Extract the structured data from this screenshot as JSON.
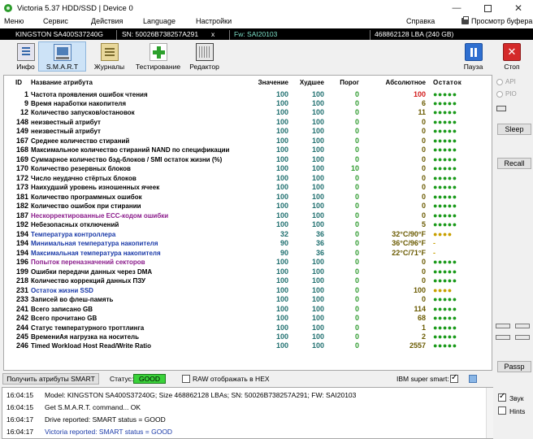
{
  "window": {
    "title": "Victoria 5.37 HDD/SSD | Device 0"
  },
  "menu": {
    "items": [
      "Меню",
      "Сервис",
      "Действия",
      "Language",
      "Настройки"
    ],
    "help": "Справка",
    "buffer": "Просмотр буфера"
  },
  "device": {
    "model": "KINGSTON SA400S37240G",
    "sn": "SN: 50026B738257A291",
    "close": "x",
    "fw": "Fw: SAI20103",
    "lba": "468862128 LBA (240 GB)"
  },
  "toolbar": {
    "info": "Инфо",
    "smart": "S.M.A.R.T",
    "journals": "Журналы",
    "testing": "Тестирование",
    "editor": "Редактор",
    "pause": "Пауза",
    "stop": "Стоп"
  },
  "smart": {
    "headers": {
      "id": "ID",
      "name": "Название атрибута",
      "value": "Значение",
      "worst": "Худшее",
      "threshold": "Порог",
      "absolute": "Абсолютное",
      "remaining": "Остаток"
    },
    "rows": [
      {
        "id": "1",
        "name": "Частота проявления ошибок чтения",
        "value": "100",
        "worst": "100",
        "threshold": "0",
        "absolute": "100",
        "remaining": "●●●●●"
      },
      {
        "id": "9",
        "name": "Время наработки накопителя",
        "value": "100",
        "worst": "100",
        "threshold": "0",
        "absolute": "6",
        "remaining": "●●●●●"
      },
      {
        "id": "12",
        "name": "Количество запусков/остановок",
        "value": "100",
        "worst": "100",
        "threshold": "0",
        "absolute": "11",
        "remaining": "●●●●●"
      },
      {
        "id": "148",
        "name": "неизвестный атрибут",
        "value": "100",
        "worst": "100",
        "threshold": "0",
        "absolute": "0",
        "remaining": "●●●●●"
      },
      {
        "id": "149",
        "name": "неизвестный атрибут",
        "value": "100",
        "worst": "100",
        "threshold": "0",
        "absolute": "0",
        "remaining": "●●●●●"
      },
      {
        "id": "167",
        "name": "Среднее количество стираний",
        "value": "100",
        "worst": "100",
        "threshold": "0",
        "absolute": "0",
        "remaining": "●●●●●"
      },
      {
        "id": "168",
        "name": "Максимальное количество стираний NAND по спецификации",
        "value": "100",
        "worst": "100",
        "threshold": "0",
        "absolute": "0",
        "remaining": "●●●●●"
      },
      {
        "id": "169",
        "name": "Суммарное количество бэд-блоков / SMI остаток жизни (%)",
        "value": "100",
        "worst": "100",
        "threshold": "0",
        "absolute": "0",
        "remaining": "●●●●●"
      },
      {
        "id": "170",
        "name": "Количество резервных блоков",
        "value": "100",
        "worst": "100",
        "threshold": "10",
        "absolute": "0",
        "remaining": "●●●●●"
      },
      {
        "id": "172",
        "name": "Число неудачно стёртых блоков",
        "value": "100",
        "worst": "100",
        "threshold": "0",
        "absolute": "0",
        "remaining": "●●●●●"
      },
      {
        "id": "173",
        "name": "Наихудший уровень изношенных ячеек",
        "value": "100",
        "worst": "100",
        "threshold": "0",
        "absolute": "0",
        "remaining": "●●●●●"
      },
      {
        "id": "181",
        "name": "Количество программных ошибок",
        "value": "100",
        "worst": "100",
        "threshold": "0",
        "absolute": "0",
        "remaining": "●●●●●"
      },
      {
        "id": "182",
        "name": "Количество ошибок при стирании",
        "value": "100",
        "worst": "100",
        "threshold": "0",
        "absolute": "0",
        "remaining": "●●●●●"
      },
      {
        "id": "187",
        "name": "Нескорректированные ECC-кодом ошибки",
        "value": "100",
        "worst": "100",
        "threshold": "0",
        "absolute": "0",
        "remaining": "●●●●●",
        "style": "warn"
      },
      {
        "id": "192",
        "name": "Небезопасных отключений",
        "value": "100",
        "worst": "100",
        "threshold": "0",
        "absolute": "5",
        "remaining": "●●●●●"
      },
      {
        "id": "194",
        "name": "Температура контроллера",
        "value": "32",
        "worst": "36",
        "threshold": "0",
        "absolute": "32°C/90°F",
        "remaining": "●●●●",
        "style": "sel"
      },
      {
        "id": "194",
        "name": "Минимальная температура накопителя",
        "value": "90",
        "worst": "36",
        "threshold": "0",
        "absolute": "36°C/96°F",
        "remaining": "-",
        "style": "sel"
      },
      {
        "id": "194",
        "name": "Максимальная температура накопителя",
        "value": "90",
        "worst": "36",
        "threshold": "0",
        "absolute": "22°C/71°F",
        "remaining": "-",
        "style": "sel"
      },
      {
        "id": "196",
        "name": "Попыток переназначений секторов",
        "value": "100",
        "worst": "100",
        "threshold": "0",
        "absolute": "0",
        "remaining": "●●●●●",
        "style": "warn"
      },
      {
        "id": "199",
        "name": "Ошибки передачи данных через DMA",
        "value": "100",
        "worst": "100",
        "threshold": "0",
        "absolute": "0",
        "remaining": "●●●●●"
      },
      {
        "id": "218",
        "name": "Количество коррекций данных ПЗУ",
        "value": "100",
        "worst": "100",
        "threshold": "0",
        "absolute": "0",
        "remaining": "●●●●●"
      },
      {
        "id": "231",
        "name": "Остаток жизни SSD",
        "value": "100",
        "worst": "100",
        "threshold": "0",
        "absolute": "100",
        "remaining": "●●●●",
        "style": "sel"
      },
      {
        "id": "233",
        "name": "Записей во флеш-память",
        "value": "100",
        "worst": "100",
        "threshold": "0",
        "absolute": "0",
        "remaining": "●●●●●"
      },
      {
        "id": "241",
        "name": "Всего записано GB",
        "value": "100",
        "worst": "100",
        "threshold": "0",
        "absolute": "114",
        "remaining": "●●●●●"
      },
      {
        "id": "242",
        "name": "Всего прочитано GB",
        "value": "100",
        "worst": "100",
        "threshold": "0",
        "absolute": "68",
        "remaining": "●●●●●"
      },
      {
        "id": "244",
        "name": "Статус температурного троттлинга",
        "value": "100",
        "worst": "100",
        "threshold": "0",
        "absolute": "1",
        "remaining": "●●●●●"
      },
      {
        "id": "245",
        "name": "ВремениАя нагрузка на носитель",
        "value": "100",
        "worst": "100",
        "threshold": "0",
        "absolute": "2",
        "remaining": "●●●●●"
      },
      {
        "id": "246",
        "name": "Timed Workload Host Read/Write Ratio",
        "value": "100",
        "worst": "100",
        "threshold": "0",
        "absolute": "2557",
        "remaining": "●●●●●"
      }
    ]
  },
  "side": {
    "api": "API",
    "pio": "PIO",
    "sleep": "Sleep",
    "recall": "Recall",
    "passp": "Passp"
  },
  "controls": {
    "get_smart": "Получить атрибуты SMART",
    "status_label": "Статус:",
    "status_value": "GOOD",
    "raw_hex": "RAW отображать в HEX",
    "ibm_label": "IBM super smart:"
  },
  "log": [
    {
      "time": "16:04:15",
      "msg": "Model: KINGSTON SA400S37240G; Size 468862128 LBAs; SN: 50026B738257A291; FW: SAI20103"
    },
    {
      "time": "16:04:15",
      "msg": "Get S.M.A.R.T. command... OK"
    },
    {
      "time": "16:04:17",
      "msg": "Drive reported: SMART status = GOOD"
    },
    {
      "time": "16:04:17",
      "msg": "Victoria reported: SMART status = GOOD",
      "style": "blue"
    }
  ],
  "options": {
    "sound": "Звук",
    "hints": "Hints"
  },
  "colors": {
    "status_good": "#3ad23a",
    "selected_text": "#1a3aa8",
    "warn_text": "#8a1a8a"
  }
}
